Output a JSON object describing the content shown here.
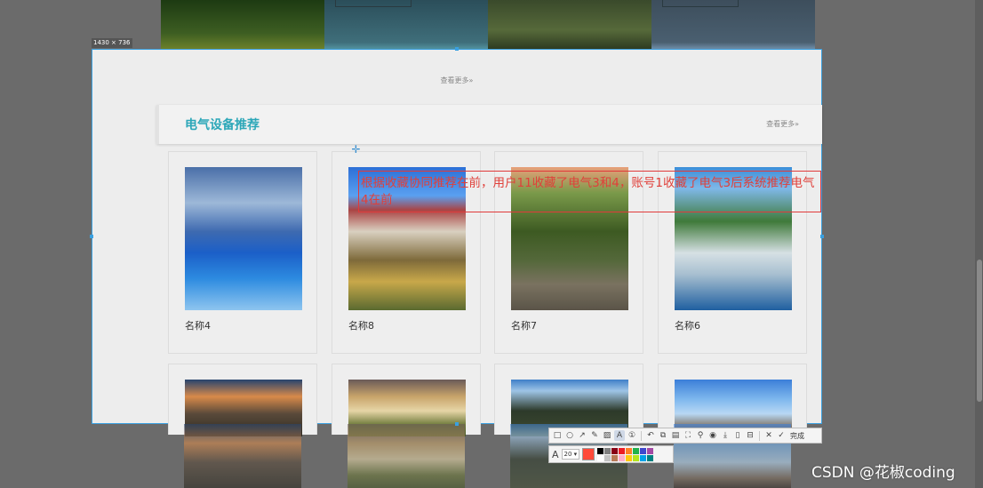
{
  "capture": {
    "dimension_label": "1430 × 736"
  },
  "page": {
    "see_more_top": "查看更多»",
    "section": {
      "title": "电气设备推荐",
      "see_more": "查看更多»"
    },
    "cards_row1": [
      {
        "name": "名称4",
        "image": "mountain-lake-photo"
      },
      {
        "name": "名称8",
        "image": "potala-palace-photo"
      },
      {
        "name": "名称7",
        "image": "tree-tunnel-road-photo"
      },
      {
        "name": "名称6",
        "image": "misty-lake-boat-photo"
      }
    ],
    "cards_row2": [
      {
        "image": "sunset-mountains-photo"
      },
      {
        "image": "lone-tree-photo"
      },
      {
        "image": "karst-peaks-photo"
      },
      {
        "image": "temple-sky-photo"
      }
    ]
  },
  "annotation": {
    "text": "根据收藏协同推荐在前，用户11收藏了电气3和4，账号1收藏了电气3后系统推荐电气4在前",
    "color": "#e0403a"
  },
  "toolbar": {
    "tools": [
      "rectangle-icon",
      "ellipse-icon",
      "arrow-icon",
      "pen-icon",
      "mosaic-icon",
      "text-icon",
      "number-icon",
      "undo-icon",
      "pin-icon",
      "ocr-icon",
      "fullscreen-icon",
      "pushpin-icon",
      "record-icon",
      "download-icon",
      "save-icon",
      "translate-icon",
      "close-icon",
      "check-icon"
    ],
    "done_label": "完成",
    "font_size": "20",
    "current_color": "#ff4a3a",
    "palette": [
      "#000000",
      "#7f7f7f",
      "#880015",
      "#ed1c24",
      "#ff7f27",
      "#22b14c",
      "#3f48cc",
      "#a349a4",
      "#ffffff",
      "#c3c3c3",
      "#b97a57",
      "#ffaec9",
      "#ffc90e",
      "#b5e61d",
      "#00a2e8",
      "#008080"
    ]
  },
  "watermark": "CSDN @花椒coding"
}
